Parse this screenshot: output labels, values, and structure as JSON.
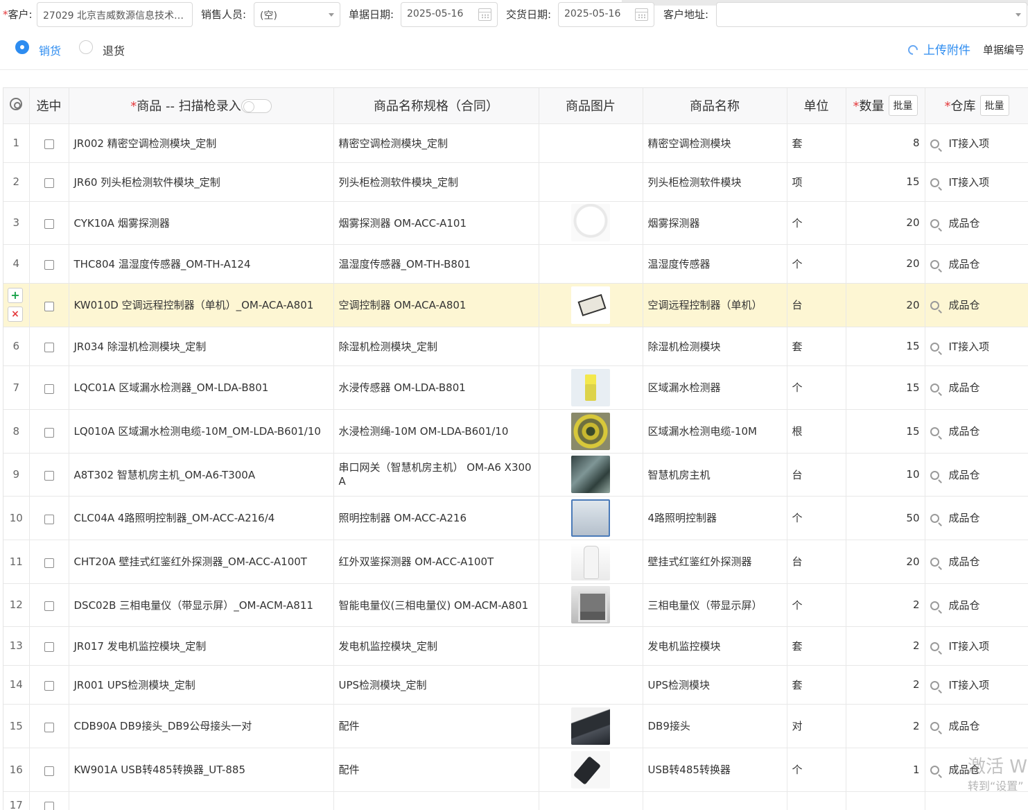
{
  "header": {
    "customer_label": "客户:",
    "customer_value": "27029 北京吉威数源信息技术…",
    "sales_label": "销售人员:",
    "sales_value": "(空)",
    "doc_date_label": "单据日期:",
    "doc_date_value": "2025-05-16",
    "delivery_date_label": "交货日期:",
    "delivery_date_value": "2025-05-16",
    "address_label": "客户地址:",
    "address_value": ""
  },
  "type_options": [
    {
      "label": "销货",
      "selected": true
    },
    {
      "label": "退货",
      "selected": false
    }
  ],
  "upload_label": "上传附件",
  "doc_no_label": "单据编号",
  "columns": {
    "select": "选中",
    "product": "商品 -- 扫描枪录入",
    "spec": "商品名称规格（合同）",
    "image": "商品图片",
    "name": "商品名称",
    "unit": "单位",
    "qty": "数量",
    "warehouse": "仓库",
    "batch": "批量"
  },
  "rows": [
    {
      "idx": "1",
      "product": "JR002 精密空调检测模块_定制",
      "spec": "精密空调检测模块_定制",
      "image": "",
      "name": "精密空调检测模块",
      "unit": "套",
      "qty": "8",
      "warehouse": "IT接入项"
    },
    {
      "idx": "2",
      "product": "JR60 列头柜检测软件模块_定制",
      "spec": "列头柜检测软件模块_定制",
      "image": "",
      "name": "列头柜检测软件模块",
      "unit": "项",
      "qty": "15",
      "warehouse": "IT接入项"
    },
    {
      "idx": "3",
      "product": "CYK10A 烟雾探测器",
      "spec": "烟雾探测器 OM-ACC-A101",
      "image": "smoke",
      "name": "烟雾探测器",
      "unit": "个",
      "qty": "20",
      "warehouse": "成品仓"
    },
    {
      "idx": "4",
      "product": "THC804 温湿度传感器_OM-TH-A124",
      "spec": "温湿度传感器_OM-TH-B801",
      "image": "",
      "name": "温湿度传感器",
      "unit": "个",
      "qty": "20",
      "warehouse": "成品仓"
    },
    {
      "idx": "",
      "product": "KW010D 空调远程控制器（单机）_OM-ACA-A801",
      "spec": "空调控制器 OM-ACA-A801",
      "image": "ctrl",
      "name": "空调远程控制器（单机）",
      "unit": "台",
      "qty": "20",
      "warehouse": "成品仓",
      "highlight": true
    },
    {
      "idx": "6",
      "product": "JR034 除湿机检测模块_定制",
      "spec": "除湿机检测模块_定制",
      "image": "",
      "name": "除湿机检测模块",
      "unit": "套",
      "qty": "15",
      "warehouse": "IT接入项"
    },
    {
      "idx": "7",
      "product": "LQC01A 区域漏水检测器_OM-LDA-B801",
      "spec": "水浸传感器 OM-LDA-B801",
      "image": "water",
      "name": "区域漏水检测器",
      "unit": "个",
      "qty": "15",
      "warehouse": "成品仓"
    },
    {
      "idx": "8",
      "product": "LQ010A 区域漏水检测电缆-10M_OM-LDA-B601/10",
      "spec": "水浸检测绳-10M OM-LDA-B601/10",
      "image": "cable",
      "name": "区域漏水检测电缆-10M",
      "unit": "根",
      "qty": "15",
      "warehouse": "成品仓"
    },
    {
      "idx": "9",
      "product": "A8T302 智慧机房主机_OM-A6-T300A",
      "spec": "串口网关（智慧机房主机） OM-A6 X300 A",
      "image": "host",
      "name": "智慧机房主机",
      "unit": "台",
      "qty": "10",
      "warehouse": "成品仓"
    },
    {
      "idx": "10",
      "product": "CLC04A 4路照明控制器_OM-ACC-A216/4",
      "spec": "照明控制器 OM-ACC-A216",
      "image": "light",
      "name": "4路照明控制器",
      "unit": "个",
      "qty": "50",
      "warehouse": "成品仓"
    },
    {
      "idx": "11",
      "product": "CHT20A 壁挂式红鉴红外探测器_OM-ACC-A100T",
      "spec": "红外双鉴探测器 OM-ACC-A100T",
      "image": "ir",
      "name": "壁挂式红鉴红外探测器",
      "unit": "台",
      "qty": "20",
      "warehouse": "成品仓"
    },
    {
      "idx": "12",
      "product": "DSC02B 三相电量仪（带显示屏）_OM-ACM-A811",
      "spec": "智能电量仪(三相电量仪) OM-ACM-A801",
      "image": "meter",
      "name": "三相电量仪（带显示屏）",
      "unit": "个",
      "qty": "2",
      "warehouse": "成品仓"
    },
    {
      "idx": "13",
      "product": "JR017 发电机监控模块_定制",
      "spec": "发电机监控模块_定制",
      "image": "",
      "name": "发电机监控模块",
      "unit": "套",
      "qty": "2",
      "warehouse": "IT接入项"
    },
    {
      "idx": "14",
      "product": "JR001 UPS检测模块_定制",
      "spec": "UPS检测模块_定制",
      "image": "",
      "name": "UPS检测模块",
      "unit": "套",
      "qty": "2",
      "warehouse": "IT接入项"
    },
    {
      "idx": "15",
      "product": "CDB90A DB9接头_DB9公母接头一对",
      "spec": "配件",
      "image": "db9",
      "name": "DB9接头",
      "unit": "对",
      "qty": "2",
      "warehouse": "成品仓"
    },
    {
      "idx": "16",
      "product": "KW901A USB转485转换器_UT-885",
      "spec": "配件",
      "image": "usb",
      "name": "USB转485转换器",
      "unit": "个",
      "qty": "1",
      "warehouse": "成品仓"
    },
    {
      "idx": "17",
      "product": "",
      "spec": "",
      "image": "",
      "name": "",
      "unit": "",
      "qty": "",
      "warehouse": ""
    }
  ],
  "row_actions": {
    "add": "+",
    "delete": "×"
  },
  "watermark": {
    "line1": "激活 Wi",
    "line2": "转到“设置”"
  }
}
